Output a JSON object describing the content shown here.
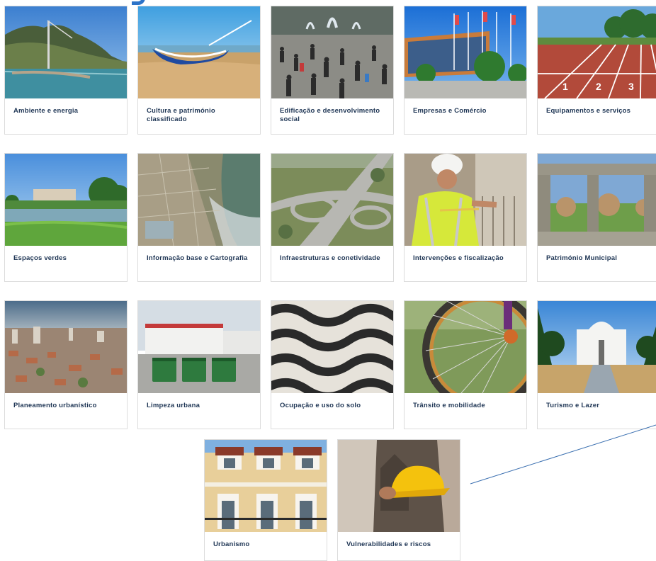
{
  "categories": [
    {
      "label": "Ambiente e energia",
      "image": "coastal-cliff-photo"
    },
    {
      "label": "Cultura e património classificado",
      "image": "boat-on-beach-photo"
    },
    {
      "label": "Edificação e desenvolvimento social",
      "image": "crowd-plaza-photo"
    },
    {
      "label": "Empresas e Comércio",
      "image": "commercial-building-photo"
    },
    {
      "label": "Equipamentos e serviços",
      "image": "running-track-photo"
    },
    {
      "label": "Espaços verdes",
      "image": "green-park-photo"
    },
    {
      "label": "Informação base e Cartografia",
      "image": "aerial-city-photo"
    },
    {
      "label": "Infraestruturas e conetividade",
      "image": "highway-interchange-photo"
    },
    {
      "label": "Intervenções e fiscalização",
      "image": "construction-worker-photo"
    },
    {
      "label": "Património Municipal",
      "image": "stone-ruins-photo"
    },
    {
      "label": "Planeamento urbanístico",
      "image": "city-panorama-photo"
    },
    {
      "label": "Limpeza urbana",
      "image": "waste-containers-photo"
    },
    {
      "label": "Ocupação e uso do solo",
      "image": "cobblestone-pavement-photo"
    },
    {
      "label": "Trânsito e mobilidade",
      "image": "bicycle-wheel-photo"
    },
    {
      "label": "Turismo e Lazer",
      "image": "white-chapel-photo"
    },
    {
      "label": "Urbanismo",
      "image": "building-facade-photo"
    },
    {
      "label": "Vulnerabilidades e riscos",
      "image": "hard-hat-photo"
    }
  ],
  "colors": {
    "label_text": "#1e3554",
    "accent": "#2d73c8",
    "card_border": "#dcdcdc"
  }
}
